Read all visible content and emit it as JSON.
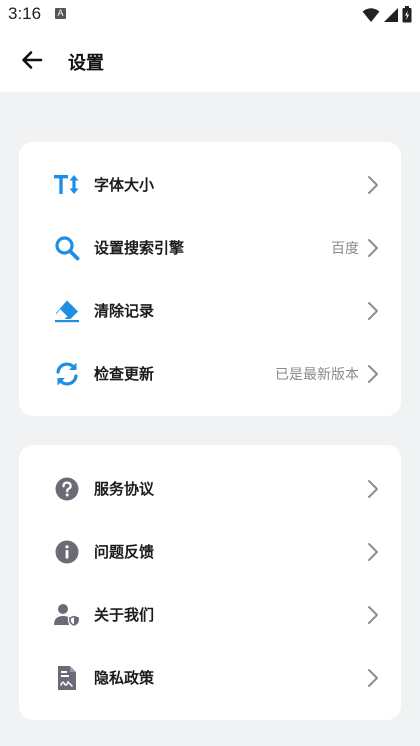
{
  "status_bar": {
    "time": "3:16",
    "notification_badge": "A",
    "icons": [
      "wifi-icon",
      "signal-icon",
      "battery-icon"
    ]
  },
  "header": {
    "title": "设置",
    "back_icon": "arrow-left-icon"
  },
  "colors": {
    "accent": "#1f8fe5",
    "secondary_icon": "#6b6b78",
    "chevron": "#8e8e8e",
    "background": "#f1f2f4",
    "card": "#ffffff"
  },
  "card1": {
    "items": [
      {
        "label": "字体大小",
        "value": "",
        "icon": "text-size-icon"
      },
      {
        "label": "设置搜索引擎",
        "value": "百度",
        "icon": "search-icon"
      },
      {
        "label": "清除记录",
        "value": "",
        "icon": "eraser-icon"
      },
      {
        "label": "检查更新",
        "value": "已是最新版本",
        "icon": "refresh-icon"
      }
    ]
  },
  "card2": {
    "items": [
      {
        "label": "服务协议",
        "value": "",
        "icon": "question-circle-icon"
      },
      {
        "label": "问题反馈",
        "value": "",
        "icon": "info-circle-icon"
      },
      {
        "label": "关于我们",
        "value": "",
        "icon": "user-shield-icon"
      },
      {
        "label": "隐私政策",
        "value": "",
        "icon": "document-icon"
      }
    ]
  }
}
